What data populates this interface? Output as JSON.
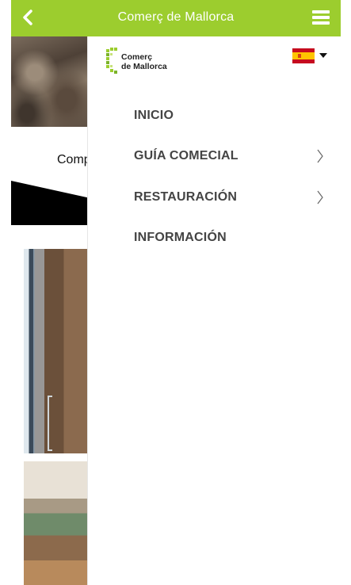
{
  "header": {
    "title": "Comerç de Mallorca",
    "back_icon": "chevron-left-icon",
    "menu_icon": "hamburger-menu-icon",
    "bg_color": "#9ccd2e"
  },
  "background_page": {
    "partial_text": "Comp"
  },
  "drawer": {
    "logo_line1": "Comerç",
    "logo_line2": "de Mallorca",
    "language_flag": "spain-flag-icon",
    "items": [
      {
        "label": "INICIO",
        "has_submenu": false
      },
      {
        "label": "GUÍA COMECIAL",
        "has_submenu": true
      },
      {
        "label": "RESTAURACIÓN",
        "has_submenu": true
      },
      {
        "label": "INFORMACIÓN",
        "has_submenu": false
      }
    ]
  },
  "colors": {
    "accent": "#9ccd2e",
    "menu_text": "#444444"
  }
}
